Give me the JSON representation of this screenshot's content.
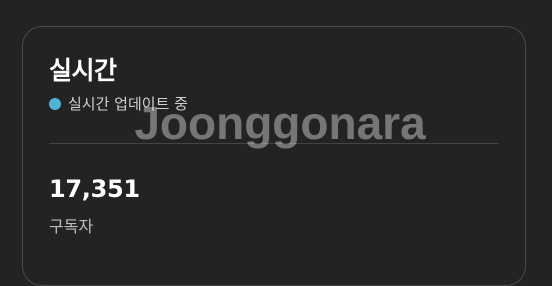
{
  "card": {
    "title": "실시간",
    "status": {
      "label": "실시간 업데이트 중",
      "dot_color": "#4fb3d9"
    },
    "stat": {
      "value": "17,351",
      "label": "구독자"
    }
  },
  "watermark": {
    "text": "Joonggonara"
  }
}
